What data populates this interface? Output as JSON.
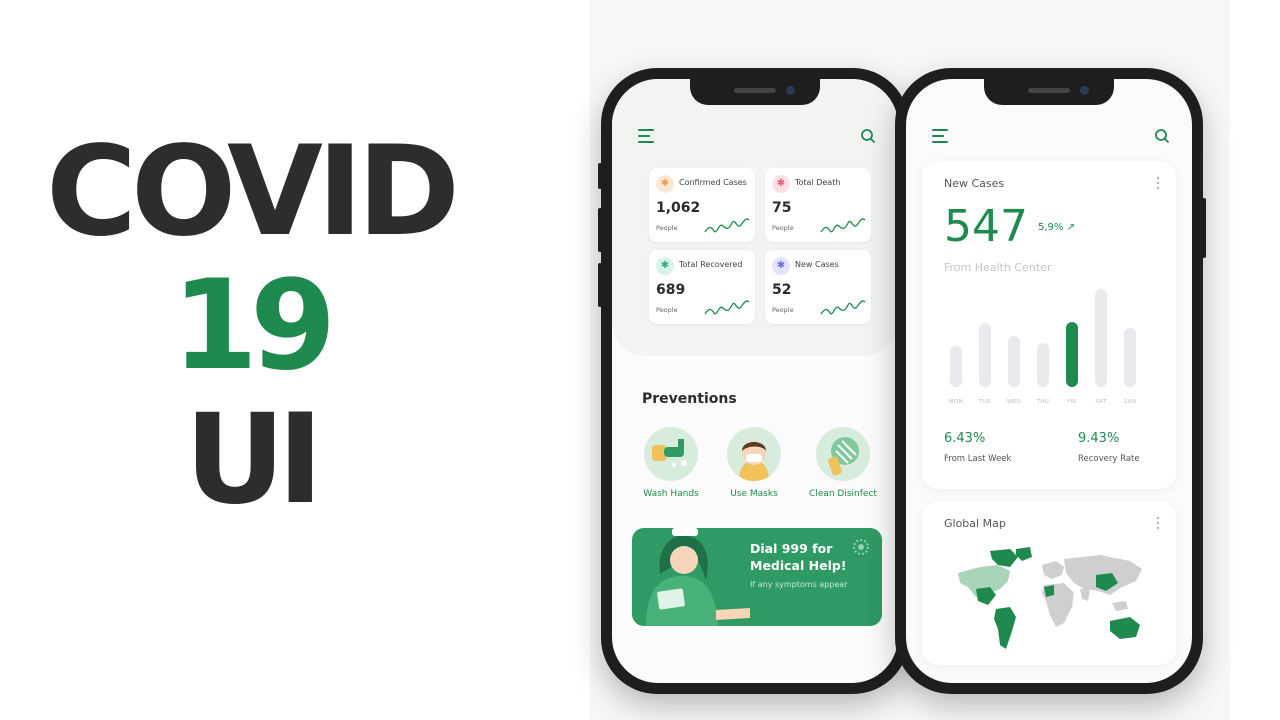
{
  "hero": {
    "line1": "COVID",
    "line2": "19",
    "line3": "UI"
  },
  "colors": {
    "accent": "#1f8a4f",
    "dark": "#2d2d2d",
    "banner": "#2f9a63"
  },
  "phone1": {
    "stats": [
      {
        "label": "Confirmed Cases",
        "value": "1,062",
        "unit": "People",
        "icon": "running-person-icon"
      },
      {
        "label": "Total Death",
        "value": "75",
        "unit": "People",
        "icon": "running-person-icon"
      },
      {
        "label": "Total Recovered",
        "value": "689",
        "unit": "People",
        "icon": "running-person-icon"
      },
      {
        "label": "New Cases",
        "value": "52",
        "unit": "People",
        "icon": "running-person-icon"
      }
    ],
    "preventions": {
      "title": "Preventions",
      "items": [
        {
          "label": "Wash Hands",
          "icon": "wash-hands-icon"
        },
        {
          "label": "Use Masks",
          "icon": "mask-icon"
        },
        {
          "label": "Clean Disinfect",
          "icon": "disinfect-icon"
        }
      ]
    },
    "banner": {
      "title_line1": "Dial 999 for",
      "title_line2": "Medical Help!",
      "subtitle": "If any symptoms appear"
    }
  },
  "phone2": {
    "new_cases": {
      "title": "New Cases",
      "value": "547",
      "change": "5,9% ↗",
      "source": "From Health Center",
      "days": [
        "MON",
        "TUE",
        "WED",
        "THU",
        "FRI",
        "SAT",
        "SUN"
      ],
      "bar_levels": [
        0.42,
        0.65,
        0.52,
        0.45,
        0.66,
        1.0,
        0.6
      ],
      "active_day": "FRI"
    },
    "metrics": [
      {
        "value": "6.43%",
        "label": "From Last Week"
      },
      {
        "value": "9.43%",
        "label": "Recovery Rate"
      }
    ],
    "global_map": {
      "title": "Global Map"
    }
  }
}
